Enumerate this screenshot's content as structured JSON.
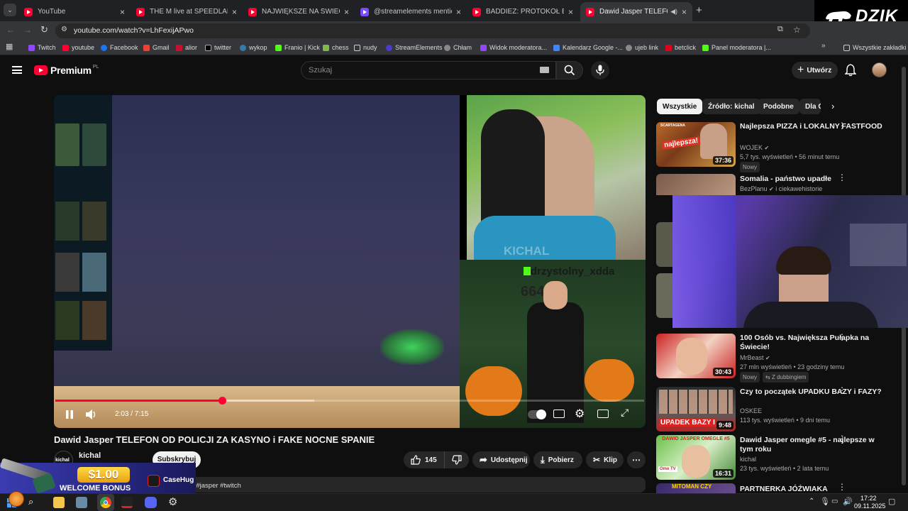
{
  "browser": {
    "tabs": [
      {
        "label": "YouTube",
        "icon": "youtube-icon",
        "active": false
      },
      {
        "label": "THE M live at SPEEDLAND FEST",
        "icon": "youtube-icon",
        "active": false
      },
      {
        "label": "NAJWIĘKSZE NA ŚWIECIE ZAW",
        "icon": "youtube-icon",
        "active": false
      },
      {
        "label": "@streamelements mentione",
        "icon": "bell-icon",
        "active": false
      },
      {
        "label": "BADDIEZ: PROTOKÓŁ BERLIN -",
        "icon": "youtube-icon",
        "active": false
      },
      {
        "label": "Dawid Jasper TELEFON OD",
        "icon": "youtube-icon",
        "active": true
      }
    ],
    "url": "youtube.com/watch?v=LhFexijAPwo",
    "bookmarks": [
      "Twitch",
      "youtube",
      "Facebook",
      "Gmail",
      "alior",
      "twitter",
      "wykop",
      "Franio | Kick",
      "chess",
      "nudy",
      "StreamElements",
      "Chłam",
      "Widok moderatora...",
      "Kalendarz Google -...",
      "ujeb link",
      "betclick",
      "Panel moderatora |..."
    ],
    "all_bookmarks": "Wszystkie zakładki",
    "overlay_logo": "DZIK"
  },
  "youtube": {
    "logo": "Premium",
    "logo_region": "PL",
    "search_placeholder": "Szukaj",
    "create_label": "Utwórz"
  },
  "player": {
    "time": "2:03 / 7:15",
    "progress": 0.283,
    "buffered": 0.44,
    "watermark": "KICHAL",
    "overlay_user": "drzystolny_xdda",
    "overlay_number": "664"
  },
  "video": {
    "title": "Dawid Jasper TELEFON OD POLICJI ZA KASYNO i FAKE NOCNE SPANIE",
    "channel": "kichal",
    "avatar_text": "kichal",
    "subscribe": "Subskrybuj",
    "likes": "145",
    "share": "Udostępnij",
    "download": "Pobierz",
    "clip": "Klip",
    "description_tags": "per #jasper #twitch"
  },
  "chips": [
    "Wszystkie",
    "Źródło: kichal",
    "Podobne",
    "Dla C"
  ],
  "recommendations": [
    {
      "title": "Najlepsza PIZZA i LOKALNY FASTFOOD",
      "channel": "WOJEK",
      "meta": "5,7 tys. wyświetleń • 56 minut temu",
      "badge": "Nowy",
      "duration": "37:36"
    },
    {
      "title": "Somalia - państwo upadłe",
      "channel": "BezPlanu",
      "meta": "i ciekawehistorie",
      "badge": "",
      "duration": ""
    },
    {
      "title": "100 Osób vs. Największa Pułapka na Świecie!",
      "channel": "MrBeast",
      "meta": "27 mln wyświetleń • 23 godziny temu",
      "badge": "Nowy",
      "badge2": "Z dubbingiem",
      "duration": "30:43"
    },
    {
      "title": "Czy to początek UPADKU BAZY i FAZY?",
      "channel": "OSKEE",
      "meta": "113 tys. wyświetleń • 9 dni temu",
      "badge": "",
      "duration": "9:48"
    },
    {
      "title": "Dawid Jasper omegle #5 - najlepsze w tym roku",
      "channel": "kichal",
      "meta": "23 tys. wyświetleń • 2 lata temu",
      "badge": "",
      "duration": "16:31"
    },
    {
      "title": "PARTNERKA JÓŹWIAKA",
      "channel": "",
      "meta": "",
      "badge": "",
      "duration": ""
    }
  ],
  "thumb_texts": {
    "t1": "najlepsza!",
    "t1_tag": "SCARTAGENA",
    "t4": "UPADEK BAZY I",
    "t5": "DAWID JASPER OMEGLE #5",
    "t5_logo": "Ome TV",
    "t6": "MITOMAN CZY"
  },
  "ad": {
    "amount": "$1.00",
    "text": "WELCOME BONUS",
    "brand": "CaseHug"
  },
  "taskbar": {
    "time": "17:22",
    "date": "09.11.2025"
  }
}
